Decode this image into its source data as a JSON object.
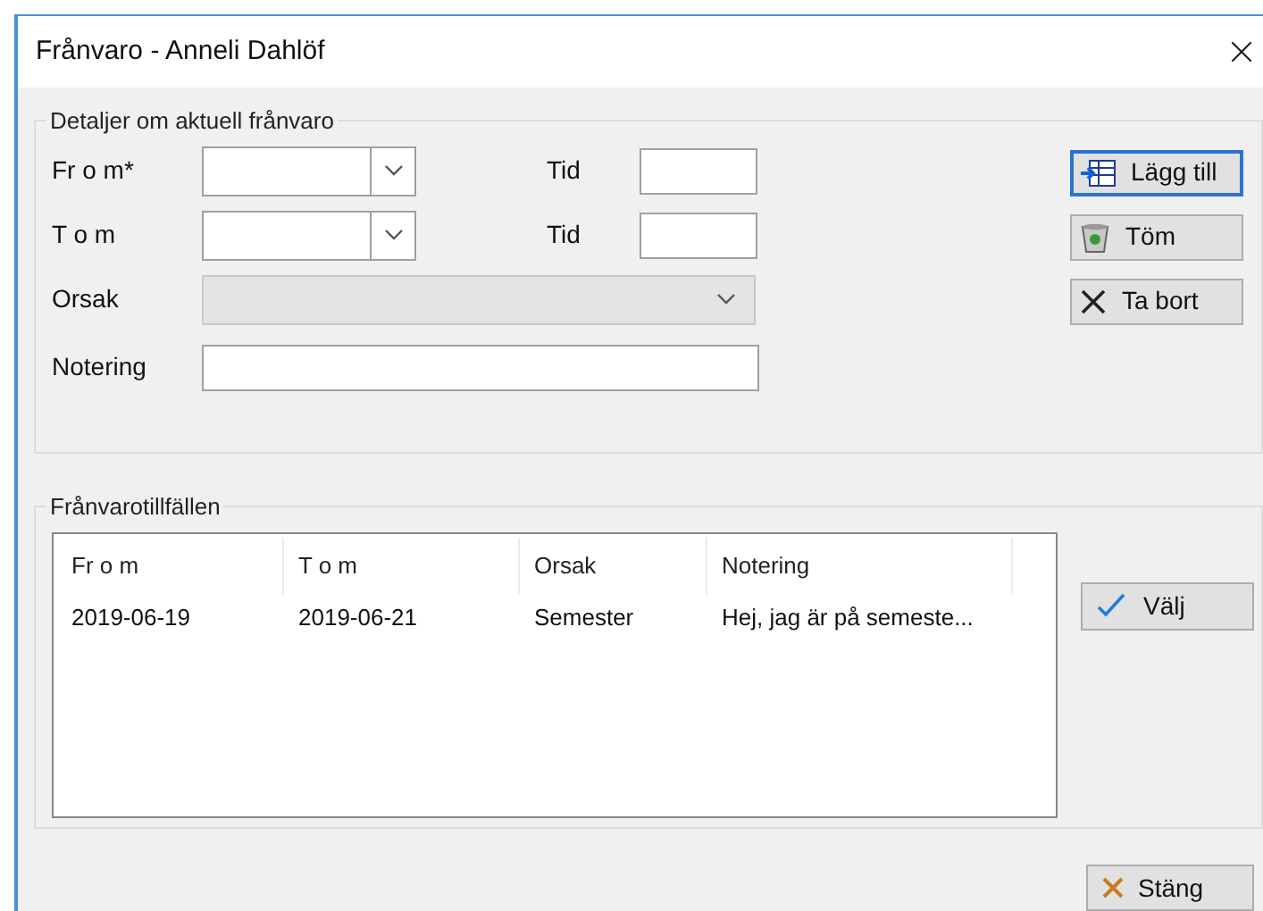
{
  "window": {
    "title": "Frånvaro - Anneli Dahlöf"
  },
  "details": {
    "legend": "Detaljer om aktuell frånvaro",
    "from_label": "Fr o m*",
    "from_time_label": "Tid",
    "to_label": "T o m",
    "to_time_label": "Tid",
    "reason_label": "Orsak",
    "reason_disabled": true,
    "note_label": "Notering"
  },
  "actions": [
    {
      "kind": "add",
      "label": "Lägg till",
      "focused": true
    },
    {
      "kind": "clear",
      "label": "Töm",
      "focused": false
    },
    {
      "kind": "remove",
      "label": "Ta bort",
      "focused": false
    }
  ],
  "occasions": {
    "legend": "Frånvarotillfällen",
    "columns": [
      "Fr o m",
      "T o m",
      "Orsak",
      "Notering"
    ],
    "rows": [
      {
        "cells": [
          "2019-06-19",
          "2019-06-21",
          "Semester",
          "Hej, jag är på semeste..."
        ],
        "selected": false
      }
    ]
  },
  "select_button": "Välj",
  "close_button": "Stäng"
}
